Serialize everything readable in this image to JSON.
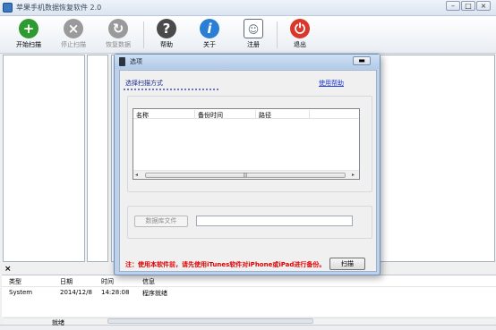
{
  "window": {
    "title": "苹果手机数据恢复软件 2.0",
    "controls": [
      "–",
      "□",
      "×"
    ]
  },
  "toolbar": {
    "buttons": [
      {
        "label": "开始扫描",
        "icon": "plus-circle-icon",
        "color": "#2f9a2f",
        "enabled": true
      },
      {
        "label": "停止扫描",
        "icon": "stop-x-icon",
        "color": "#9a9a9a",
        "enabled": false
      },
      {
        "label": "恢复数据",
        "icon": "refresh-icon",
        "color": "#9a9a9a",
        "enabled": false
      },
      {
        "label": "帮助",
        "icon": "question-icon",
        "color": "#4a4a4a",
        "enabled": true
      },
      {
        "label": "关于",
        "icon": "info-icon",
        "color": "#2a7fd4",
        "enabled": true
      },
      {
        "label": "注册",
        "icon": "user-icon",
        "color": "#5a6a7a",
        "enabled": true
      },
      {
        "label": "退出",
        "icon": "power-icon",
        "color": "#d9372b",
        "enabled": true
      }
    ]
  },
  "dialog": {
    "title": "选项",
    "minimize": "▬",
    "scan_mode_label": "选择扫描方式",
    "help_link": "使用帮助",
    "table": {
      "columns": [
        "名称",
        "备份时间",
        "路径"
      ],
      "rows": []
    },
    "db_file_button": "数据库文件",
    "db_path": "",
    "notice": "注：使用本软件前，请先使用iTunes软件对iPhone或iPad进行备份。",
    "scan_button": "扫描"
  },
  "log": {
    "close": "×",
    "columns": [
      "类型",
      "日期",
      "时间",
      "信息"
    ],
    "rows": [
      {
        "type": "System",
        "date": "2014/12/8",
        "time": "14:28:08",
        "info": "程序就绪"
      }
    ]
  },
  "statusbar": {
    "text": "就绪"
  }
}
